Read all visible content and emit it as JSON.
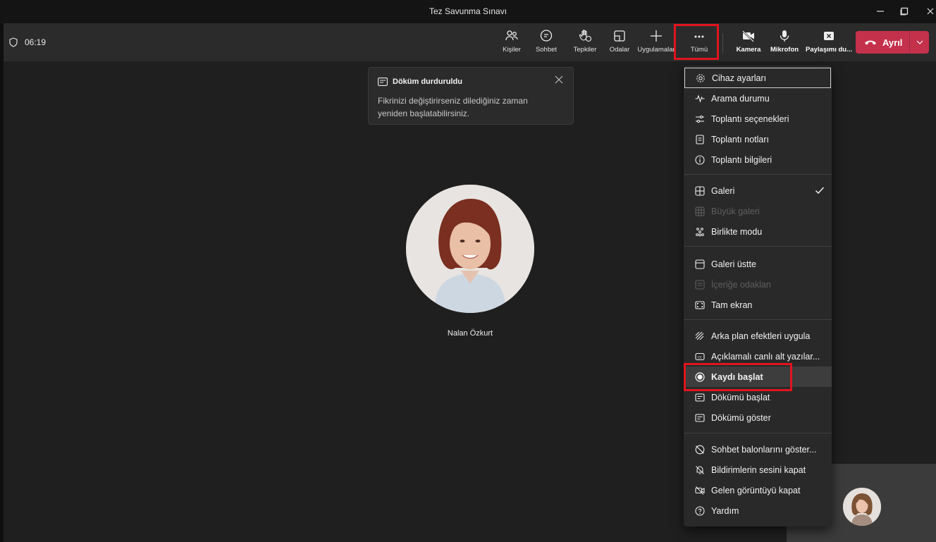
{
  "window": {
    "title": "Tez Savunma Sınavı"
  },
  "call": {
    "timer": "06:19"
  },
  "toolbar": {
    "people": "Kişiler",
    "chat": "Sohbet",
    "reactions": "Tepkiler",
    "rooms": "Odalar",
    "apps": "Uygulamalar",
    "more": "Tümü",
    "camera": "Kamera",
    "mic": "Mikrofon",
    "share": "Paylaşımı du...",
    "leave": "Ayrıl"
  },
  "banner": {
    "title": "Döküm durduruldu",
    "text": "Fikrinizi değiştirirseniz dilediğiniz zaman yeniden başlatabilirsiniz."
  },
  "participant": {
    "name": "Nalan Özkurt"
  },
  "menu": {
    "items": [
      {
        "label": "Cihaz ayarları",
        "icon": "gear-icon"
      },
      {
        "label": "Arama durumu",
        "icon": "pulse-icon"
      },
      {
        "label": "Toplantı seçenekleri",
        "icon": "sliders-icon"
      },
      {
        "label": "Toplantı notları",
        "icon": "notes-icon"
      },
      {
        "label": "Toplantı bilgileri",
        "icon": "info-icon"
      },
      {
        "label": "Galeri",
        "icon": "gallery-icon"
      },
      {
        "label": "Büyük galeri",
        "icon": "large-gallery-icon"
      },
      {
        "label": "Birlikte modu",
        "icon": "together-mode-icon"
      },
      {
        "label": "Galeri üstte",
        "icon": "gallery-top-icon"
      },
      {
        "label": "İçeriğe odaklan",
        "icon": "focus-content-icon"
      },
      {
        "label": "Tam ekran",
        "icon": "fullscreen-icon"
      },
      {
        "label": "Arka plan efektleri uygula",
        "icon": "background-effects-icon"
      },
      {
        "label": "Açıklamalı canlı alt yazılar...",
        "icon": "captions-icon"
      },
      {
        "label": "Kaydı başlat",
        "icon": "record-icon"
      },
      {
        "label": "Dökümü başlat",
        "icon": "transcript-icon"
      },
      {
        "label": "Dökümü göster",
        "icon": "transcript-show-icon"
      },
      {
        "label": "Sohbet balonlarını göster...",
        "icon": "chat-bubble-off-icon"
      },
      {
        "label": "Bildirimlerin sesini kapat",
        "icon": "bell-off-icon"
      },
      {
        "label": "Gelen görüntüyü kapat",
        "icon": "video-off-icon"
      },
      {
        "label": "Yardım",
        "icon": "help-icon"
      }
    ]
  },
  "colors": {
    "leave": "#c4314b",
    "highlight": "#e0141e",
    "menu_bg": "#292929"
  }
}
